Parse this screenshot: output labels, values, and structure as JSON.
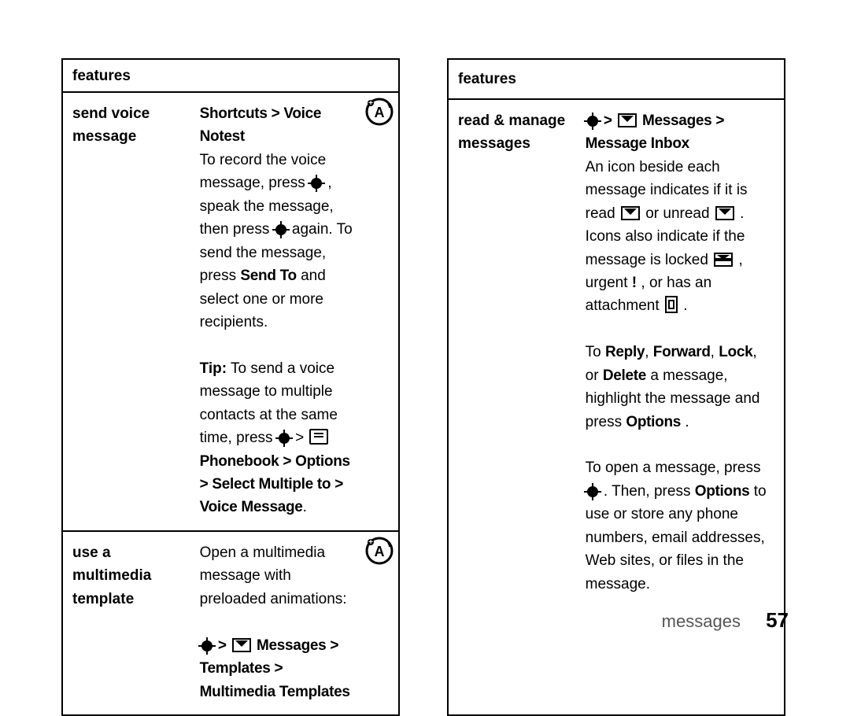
{
  "left": {
    "header": "features",
    "rows": [
      {
        "label": "send voice message",
        "path": "Shortcuts > Voice Notest",
        "para1a": "To record the voice message, press ",
        "para1b": ", speak the message, then press ",
        "para1c": " again. To send the message, press ",
        "send_to": "Send To",
        "para1d": " and select one or more recipients.",
        "tip_label": "Tip:",
        "tip_a": " To send a voice message to multiple contacts at the same time, press ",
        "tip_b": " > ",
        "tip_path": " Phonebook > Options > Select Multiple to > Voice Message",
        "period": "."
      },
      {
        "label": "use a multimedia template",
        "para": "Open a multimedia message with preloaded animations:",
        "path_a": " > ",
        "path_b": " Messages > Templates > Multimedia Templates"
      }
    ]
  },
  "right": {
    "header": "features",
    "rows": [
      {
        "label": "read & manage messages",
        "path_a": " > ",
        "path_b": " Messages > Message Inbox",
        "p1a": "An icon beside each message indicates if it is read ",
        "p1b": " or unread ",
        "p1c": ". Icons also indicate if the message is locked ",
        "p1d": ", urgent ",
        "excl": "!",
        "p1e": ", or has an attachment ",
        "p1f": ".",
        "p2a": "To ",
        "reply": "Reply",
        "comma1": ", ",
        "forward": "Forward",
        "comma2": ", ",
        "lock": "Lock",
        "or": ", or ",
        "delete": "Delete",
        "p2b": " a message, highlight the message and press ",
        "options": "Options",
        "p2c": ".",
        "p3a": "To open a message, press ",
        "p3b": ". Then, press ",
        "p3c": " to use or store any phone numbers, email addresses, Web sites, or files in the message."
      }
    ]
  },
  "footer": {
    "section": "messages",
    "page": "57"
  }
}
